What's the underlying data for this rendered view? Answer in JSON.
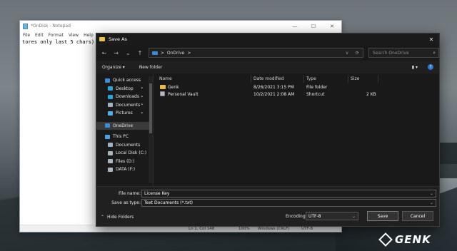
{
  "notepad": {
    "title": "*OnDisk - Notepad",
    "menu": [
      "File",
      "Edit",
      "Format",
      "View",
      "Help"
    ],
    "content": "tores only last 5 chars)",
    "status": {
      "position": "Ln 1, Col 148",
      "zoom": "100%",
      "line_ending": "Windows (CRLF)",
      "encoding": "UTF-8"
    },
    "window_controls": [
      "—",
      "☐",
      "✕"
    ]
  },
  "dialog": {
    "title": "Save As",
    "close": "✕",
    "address": {
      "path_root": "OnDrive",
      "path_separator": ">",
      "dropdown_glyph": "v",
      "refresh_glyph": "⟳"
    },
    "search_placeholder": "Search OneDrive",
    "toolbar": {
      "organize": "Organize ▾",
      "new_folder": "New folder",
      "help": "?"
    },
    "nav": [
      {
        "label": "Quick access",
        "icon": "star-icon",
        "color": "#3a8bd9",
        "indent": 1,
        "pinned": false
      },
      {
        "label": "Desktop",
        "icon": "desktop-icon",
        "color": "#2fa3d6",
        "indent": 2,
        "pinned": true
      },
      {
        "label": "Downloads",
        "icon": "download-icon",
        "color": "#2fa3d6",
        "indent": 2,
        "pinned": true
      },
      {
        "label": "Documents",
        "icon": "documents-icon",
        "color": "#9fb0c0",
        "indent": 2,
        "pinned": true
      },
      {
        "label": "Pictures",
        "icon": "pictures-icon",
        "color": "#4fb0e6",
        "indent": 2,
        "pinned": true
      },
      {
        "label": "OneDrive",
        "icon": "cloud-icon",
        "color": "#3a8bd9",
        "indent": 1,
        "pinned": false,
        "selected": true
      },
      {
        "label": "This PC",
        "icon": "pc-icon",
        "color": "#4fa3e0",
        "indent": 1,
        "pinned": false
      },
      {
        "label": "Documents",
        "icon": "documents-icon",
        "color": "#9fb0c0",
        "indent": 2,
        "pinned": false
      },
      {
        "label": "Local Disk (C:)",
        "icon": "disk-icon",
        "color": "#aab4bc",
        "indent": 2,
        "pinned": false
      },
      {
        "label": "Files (D:)",
        "icon": "disk-icon",
        "color": "#aab4bc",
        "indent": 2,
        "pinned": false
      },
      {
        "label": "DATA (F:)",
        "icon": "disk-icon",
        "color": "#aab4bc",
        "indent": 2,
        "pinned": false
      }
    ],
    "columns": [
      "Name",
      "Date modified",
      "Type",
      "Size"
    ],
    "files": [
      {
        "name": "Genk",
        "date": "8/26/2021 3:15 PM",
        "type": "File folder",
        "size": "",
        "icon": "folder-icon"
      },
      {
        "name": "Personal Vault",
        "date": "10/2/2021 2:08 AM",
        "type": "Shortcut",
        "size": "2 KB",
        "icon": "vault-icon"
      }
    ],
    "file_name_label": "File name:",
    "file_name_value": "License Key",
    "save_type_label": "Save as type:",
    "save_type_value": "Text Documents (*.txt)",
    "hide_folders": "Hide Folders",
    "encoding_label": "Encoding:",
    "encoding_value": "UTF-8",
    "save_button": "Save",
    "cancel_button": "Cancel"
  },
  "watermark": {
    "text": "GENK"
  }
}
